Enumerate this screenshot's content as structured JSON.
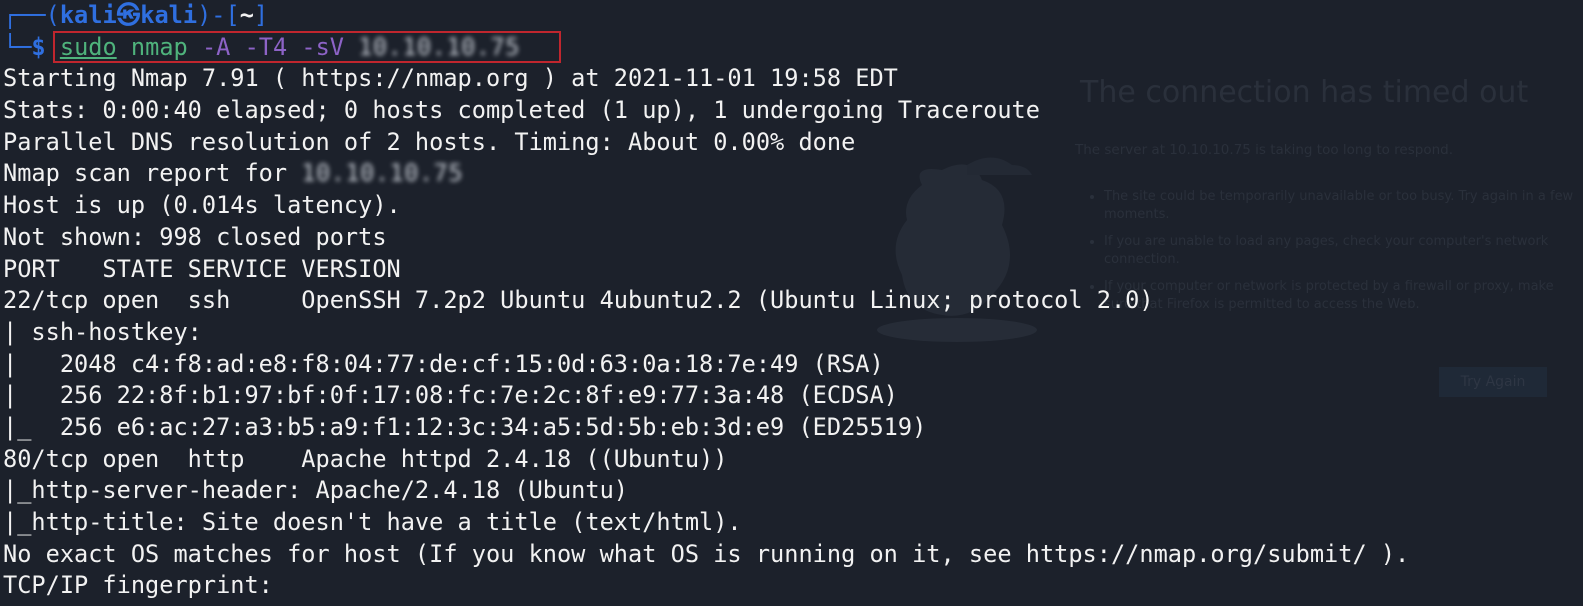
{
  "background_page": {
    "title": "The connection has timed out",
    "subtitle": "The server at 10.10.10.75 is taking too long to respond.",
    "bullets": [
      "The site could be temporarily unavailable or too busy. Try again in a few moments.",
      "If you are unable to load any pages, check your computer's network connection.",
      "If your computer or network is protected by a firewall or proxy, make sure that Firefox is permitted to access the Web."
    ],
    "try_again_label": "Try Again"
  },
  "prompt": {
    "line1_prefix": "┌──(",
    "user": "kali",
    "symbol": "㉿",
    "host": "kali",
    "line1_mid": ")-[",
    "path": "~",
    "line1_suffix": "]",
    "line2_prefix": "└─",
    "dollar": "$"
  },
  "command": {
    "sudo": "sudo",
    "program": "nmap",
    "args": "-A -T4 -sV",
    "target": "10.10.10.75"
  },
  "output": [
    "Starting Nmap 7.91 ( https://nmap.org ) at 2021-11-01 19:58 EDT",
    "Stats: 0:00:40 elapsed; 0 hosts completed (1 up), 1 undergoing Traceroute",
    "Parallel DNS resolution of 2 hosts. Timing: About 0.00% done"
  ],
  "scan_report_prefix": "Nmap scan report for ",
  "scan_report_target": "10.10.10.75",
  "output_after": [
    "Host is up (0.014s latency).",
    "Not shown: 998 closed ports",
    "PORT   STATE SERVICE VERSION",
    "22/tcp open  ssh     OpenSSH 7.2p2 Ubuntu 4ubuntu2.2 (Ubuntu Linux; protocol 2.0)",
    "| ssh-hostkey:",
    "|   2048 c4:f8:ad:e8:f8:04:77:de:cf:15:0d:63:0a:18:7e:49 (RSA)",
    "|   256 22:8f:b1:97:bf:0f:17:08:fc:7e:2c:8f:e9:77:3a:48 (ECDSA)",
    "|_  256 e6:ac:27:a3:b5:a9:f1:12:3c:34:a5:5d:5b:eb:3d:e9 (ED25519)",
    "80/tcp open  http    Apache httpd 2.4.18 ((Ubuntu))",
    "|_http-server-header: Apache/2.4.18 (Ubuntu)",
    "|_http-title: Site doesn't have a title (text/html).",
    "No exact OS matches for host (If you know what OS is running on it, see https://nmap.org/submit/ ).",
    "TCP/IP fingerprint:"
  ],
  "colors": {
    "background": "#1c212b",
    "prompt_blue": "#2f6fe0",
    "command_green": "#4fb37c",
    "argument_purple": "#8d63c7",
    "highlight_red": "#c0262e"
  }
}
